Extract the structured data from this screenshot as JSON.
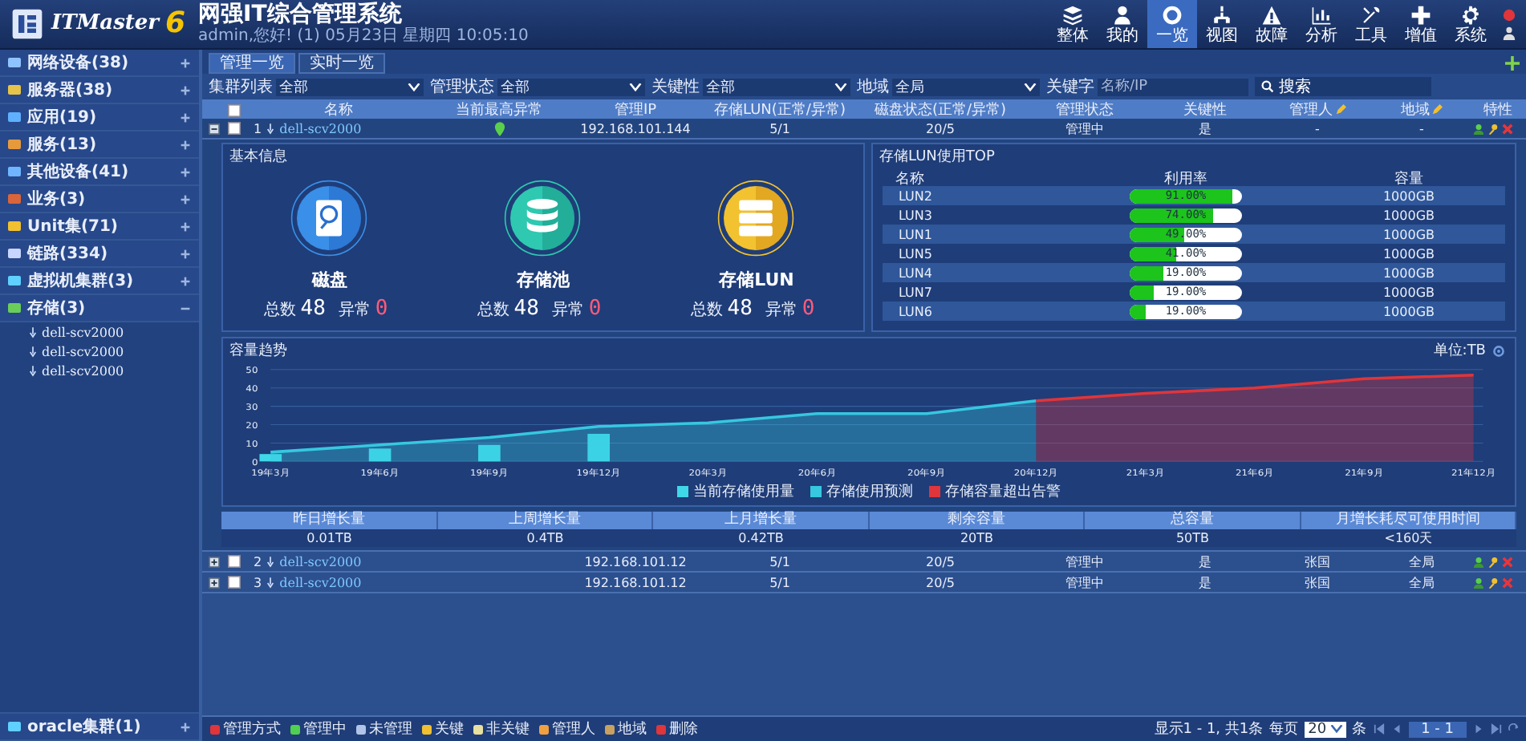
{
  "header": {
    "brand": "ITMaster",
    "version": "6",
    "title": "网强IT综合管理系统",
    "subtitle": "admin,您好! (1) 05月23日 星期四 10:05:10",
    "nav": [
      {
        "label": "整体",
        "selected": false
      },
      {
        "label": "我的",
        "selected": false
      },
      {
        "label": "一览",
        "selected": true
      },
      {
        "label": "视图",
        "selected": false
      },
      {
        "label": "故障",
        "selected": false
      },
      {
        "label": "分析",
        "selected": false
      },
      {
        "label": "工具",
        "selected": false
      },
      {
        "label": "增值",
        "selected": false
      },
      {
        "label": "系统",
        "selected": false
      }
    ]
  },
  "sidebar": {
    "items": [
      {
        "label": "网络设备(38)",
        "expanded": false
      },
      {
        "label": "服务器(38)",
        "expanded": false
      },
      {
        "label": "应用(19)",
        "expanded": false
      },
      {
        "label": "服务(13)",
        "expanded": false
      },
      {
        "label": "其他设备(41)",
        "expanded": false
      },
      {
        "label": "业务(3)",
        "expanded": false
      },
      {
        "label": "Unit集(71)",
        "expanded": false
      },
      {
        "label": "链路(334)",
        "expanded": false
      },
      {
        "label": "虚拟机集群(3)",
        "expanded": false
      },
      {
        "label": "存储(3)",
        "expanded": true,
        "children": [
          {
            "label": "dell-scv2000"
          },
          {
            "label": "dell-scv2000"
          },
          {
            "label": "dell-scv2000"
          }
        ]
      }
    ],
    "bottom_item": {
      "label": "oracle集群(1)",
      "expanded": false
    }
  },
  "tabs": [
    {
      "label": "管理一览",
      "selected": true
    },
    {
      "label": "实时一览",
      "selected": false
    }
  ],
  "filters": [
    {
      "label": "集群列表",
      "value": "全部"
    },
    {
      "label": "管理状态",
      "value": "全部"
    },
    {
      "label": "关键性",
      "value": "全部"
    },
    {
      "label": "地域",
      "value": "全局"
    }
  ],
  "search": {
    "label": "关键字",
    "placeholder": "名称/IP",
    "button": "搜索"
  },
  "table": {
    "columns": [
      "名称",
      "当前最高异常",
      "管理IP",
      "存储LUN(正常/异常)",
      "磁盘状态(正常/异常)",
      "管理状态",
      "关键性",
      "管理人",
      "地域",
      "特性"
    ],
    "header_checked": false,
    "rows": [
      {
        "index": "1",
        "name": "dell-scv2000",
        "alarm_icon": true,
        "ip": "192.168.101.144",
        "lun": "5/1",
        "disk": "20/5",
        "state": "管理中",
        "critical": "是",
        "manager": "-",
        "region": "-",
        "expanded": true,
        "checked": false
      },
      {
        "index": "2",
        "name": "dell-scv2000",
        "alarm_icon": false,
        "ip": "192.168.101.12",
        "lun": "5/1",
        "disk": "20/5",
        "state": "管理中",
        "critical": "是",
        "manager": "张国",
        "region": "全局",
        "expanded": false,
        "checked": false
      },
      {
        "index": "3",
        "name": "dell-scv2000",
        "alarm_icon": false,
        "ip": "192.168.101.12",
        "lun": "5/1",
        "disk": "20/5",
        "state": "管理中",
        "critical": "是",
        "manager": "张国",
        "region": "全局",
        "expanded": false,
        "checked": false
      }
    ]
  },
  "detail": {
    "basic": {
      "title": "基本信息",
      "items": [
        {
          "kind": "disk",
          "name": "磁盘",
          "total_label": "总数",
          "total": "48",
          "error_label": "异常",
          "errors": "0"
        },
        {
          "kind": "pool",
          "name": "存储池",
          "total_label": "总数",
          "total": "48",
          "error_label": "异常",
          "errors": "0"
        },
        {
          "kind": "lun",
          "name": "存储LUN",
          "total_label": "总数",
          "total": "48",
          "error_label": "异常",
          "errors": "0"
        }
      ]
    },
    "lun_top": {
      "title": "存储LUN使用TOP",
      "columns": [
        "名称",
        "利用率",
        "容量"
      ],
      "rows": [
        {
          "name": "LUN2",
          "level": 0.91,
          "reading": "91.00%",
          "capacity": "1000GB"
        },
        {
          "name": "LUN3",
          "level": 0.74,
          "reading": "74.00%",
          "capacity": "1000GB"
        },
        {
          "name": "LUN1",
          "level": 0.49,
          "reading": "49.00%",
          "capacity": "1000GB"
        },
        {
          "name": "LUN5",
          "level": 0.41,
          "reading": "41.00%",
          "capacity": "1000GB"
        },
        {
          "name": "LUN4",
          "level": 0.3,
          "reading": "19.00%",
          "capacity": "1000GB"
        },
        {
          "name": "LUN7",
          "level": 0.22,
          "reading": "19.00%",
          "capacity": "1000GB"
        },
        {
          "name": "LUN6",
          "level": 0.14,
          "reading": "19.00%",
          "capacity": "1000GB"
        }
      ]
    },
    "trend": {
      "title": "容量趋势",
      "unit": "单位:TB",
      "chart_data": {
        "type": "area",
        "grid": true,
        "categories": [
          "19年3月",
          "19年6月",
          "19年9月",
          "19年12月",
          "20年3月",
          "20年6月",
          "20年9月",
          "20年12月",
          "21年3月",
          "21年6月",
          "21年9月",
          "21年12月"
        ],
        "ylim": [
          0,
          50
        ],
        "yticks": [
          0,
          10,
          20,
          30,
          40,
          50
        ],
        "series": [
          {
            "name": "当前存储使用量",
            "color": "#3fd8e8",
            "type": "bar",
            "values": [
              4,
              7,
              9,
              15,
              null,
              null,
              null,
              null,
              null,
              null,
              null,
              null
            ]
          },
          {
            "name": "存储使用预测",
            "color": "#36c8e0",
            "values": [
              5,
              9,
              13,
              19,
              21,
              26,
              26,
              33,
              null,
              null,
              null,
              null
            ]
          },
          {
            "name": "存储容量超出告警",
            "color": "#e0353a",
            "values": [
              null,
              null,
              null,
              null,
              null,
              null,
              null,
              33,
              37,
              40,
              45,
              47
            ]
          }
        ]
      }
    },
    "summary": {
      "columns": [
        "昨日增长量",
        "上周增长量",
        "上月增长量",
        "剩余容量",
        "总容量",
        "月增长耗尽可使用时间"
      ],
      "values": [
        "0.01TB",
        "0.4TB",
        "0.42TB",
        "20TB",
        "50TB",
        "<160天"
      ]
    }
  },
  "legend_bar": [
    "管理方式",
    "管理中",
    "未管理",
    "关键",
    "非关键",
    "管理人",
    "地域",
    "删除"
  ],
  "pager": {
    "info": "显示1 - 1, 共1条",
    "per_page_label": "每页",
    "per_page": "20",
    "unit": "条",
    "page": "1 - 1"
  }
}
